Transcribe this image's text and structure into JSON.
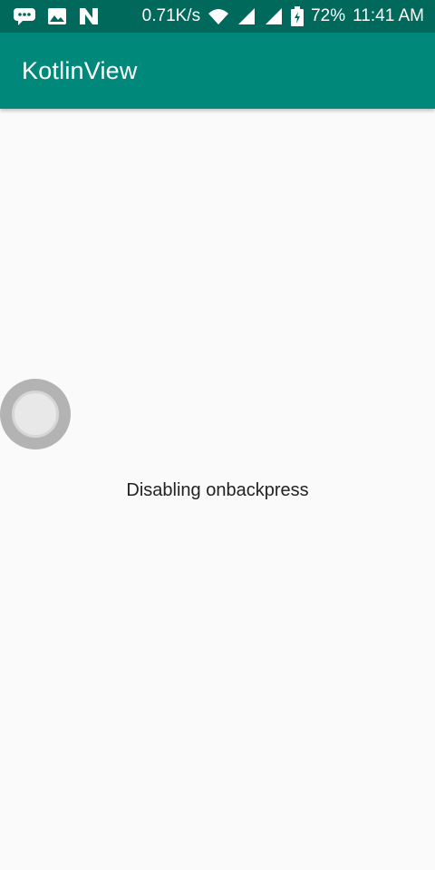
{
  "status_bar": {
    "net_speed": "0.71K/s",
    "battery": "72%",
    "time": "11:41 AM",
    "icons": [
      "message-icon",
      "image-icon",
      "n-app-icon",
      "wifi-icon",
      "signal-icon",
      "signal-icon",
      "battery-icon"
    ]
  },
  "app_bar": {
    "title": "KotlinView"
  },
  "content": {
    "message": "Disabling onbackpress"
  },
  "colors": {
    "status_bar": "#00695c",
    "app_bar": "#00897b",
    "background": "#fafafa"
  }
}
